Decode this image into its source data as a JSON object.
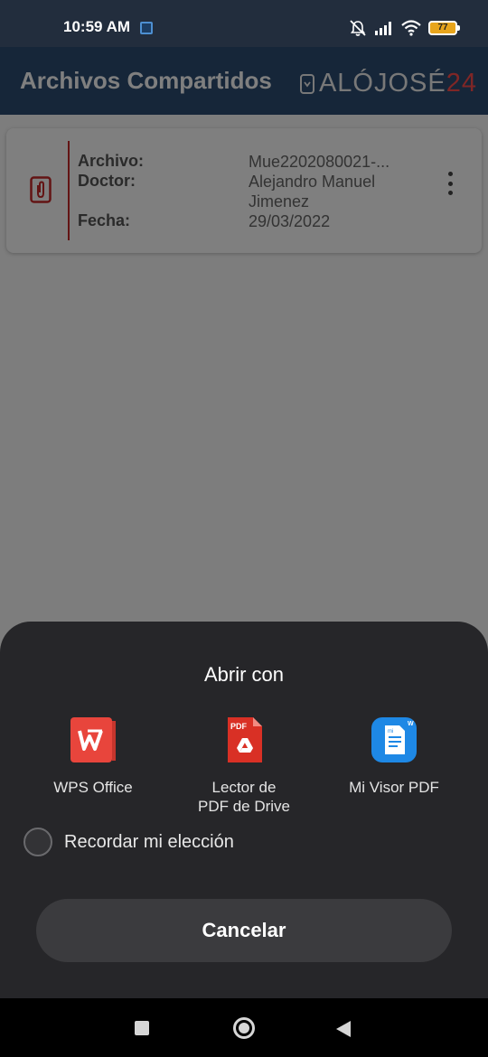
{
  "status_bar": {
    "time": "10:59 AM",
    "battery": "77"
  },
  "header": {
    "title": "Archivos Compartidos",
    "logo_text": "ALÓJOSÉ",
    "logo_accent": "24"
  },
  "card": {
    "labels": {
      "archivo": "Archivo:",
      "doctor": "Doctor:",
      "fecha": "Fecha:"
    },
    "values": {
      "archivo": "Mue2202080021-...",
      "doctor": "Alejandro Manuel Jimenez",
      "fecha": "29/03/2022"
    }
  },
  "sheet": {
    "title": "Abrir con",
    "apps": [
      {
        "label": "WPS Office",
        "icon": "wps-office-icon",
        "color": "#e8453c"
      },
      {
        "label": "Lector de\nPDF de Drive",
        "icon": "pdf-drive-icon",
        "color": "#d93025"
      },
      {
        "label": "Mi Visor PDF",
        "icon": "mi-visor-pdf-icon",
        "color": "#1e88e5"
      }
    ],
    "remember_label": "Recordar mi elección",
    "cancel_label": "Cancelar"
  },
  "colors": {
    "header_bg": "#2c4c72",
    "accent_red": "#c62828",
    "sheet_bg": "#262629"
  }
}
